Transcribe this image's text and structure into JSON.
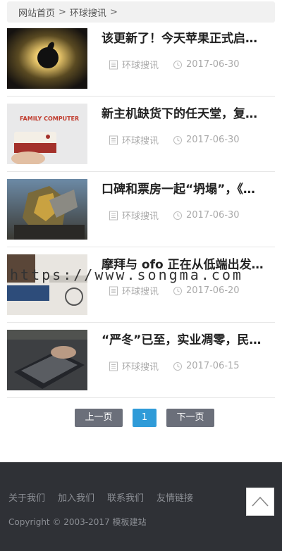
{
  "breadcrumb": {
    "home": "网站首页",
    "sep1": ">",
    "category": "环球搜讯",
    "sep2": ">"
  },
  "articles": [
    {
      "title": "该更新了！今天苹果正式启…",
      "category": "环球搜讯",
      "date": "2017-06-30"
    },
    {
      "title": "新主机缺货下的任天堂，复…",
      "category": "环球搜讯",
      "date": "2017-06-30"
    },
    {
      "title": "口碑和票房一起“坍塌”，《…",
      "category": "环球搜讯",
      "date": "2017-06-30"
    },
    {
      "title": "摩拜与 ofo 正在从低端出发…",
      "category": "环球搜讯",
      "date": "2017-06-20"
    },
    {
      "title": "“严冬”已至，实业凋零，民…",
      "category": "环球搜讯",
      "date": "2017-06-15"
    }
  ],
  "thumb_text": {
    "family": "FAMILY COMPUTER"
  },
  "pager": {
    "prev": "上一页",
    "current": "1",
    "next": "下一页"
  },
  "footer": {
    "links": [
      "关于我们",
      "加入我们",
      "联系我们",
      "友情链接"
    ],
    "copyright": "Copyright © 2003-2017 模板建站"
  },
  "watermark": "https://www.songma.com",
  "icons": {
    "category": "document-icon",
    "date": "clock-icon",
    "totop": "chevron-up-icon"
  },
  "colors": {
    "accent": "#2f9bd8",
    "pager_btn": "#6b6f7a",
    "footer_bg": "#2f3136"
  }
}
